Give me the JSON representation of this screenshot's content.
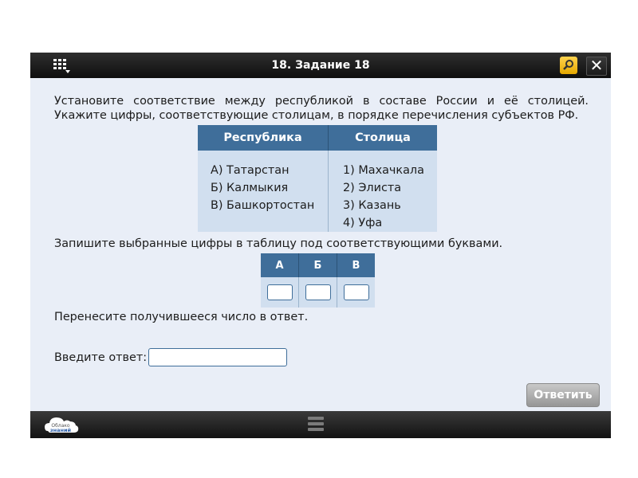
{
  "header": {
    "title": "18. Задание 18",
    "menu_icon": "grid-menu-icon",
    "search_icon": "magnifier-icon",
    "close_icon": "close-icon",
    "close_symbol": "✕"
  },
  "task": {
    "text": "Установите соответствие между республикой в составе России и её столицей. Укажите цифры, соответствующие столицам, в порядке перечисления субъектов РФ."
  },
  "match_table": {
    "headers": [
      "Республика",
      "Столица"
    ],
    "republics": [
      "А)  Татарстан",
      "Б)  Калмыкия",
      "В)  Башкортостан"
    ],
    "capitals": [
      "1)  Махачкала",
      "2)  Элиста",
      "3)  Казань",
      "4)  Уфа"
    ]
  },
  "instruction2": "Запишите выбранные цифры в таблицу под соответствующими буквами.",
  "answer_grid": {
    "letters": [
      "А",
      "Б",
      "В"
    ],
    "values": [
      "",
      "",
      ""
    ]
  },
  "instruction3": "Перенесите получившееся число в ответ.",
  "answer": {
    "label": "Введите ответ:",
    "value": ""
  },
  "submit_label": "Ответить",
  "footer": {
    "logo_icon": "oblako-znaniy-logo",
    "logo_line1": "Облако",
    "logo_line2": "знаний",
    "menu_icon": "hamburger-icon"
  },
  "colors": {
    "header_blue": "#3f6e9a",
    "cell_light": "#d1dfef",
    "background": "#e9eef7"
  }
}
